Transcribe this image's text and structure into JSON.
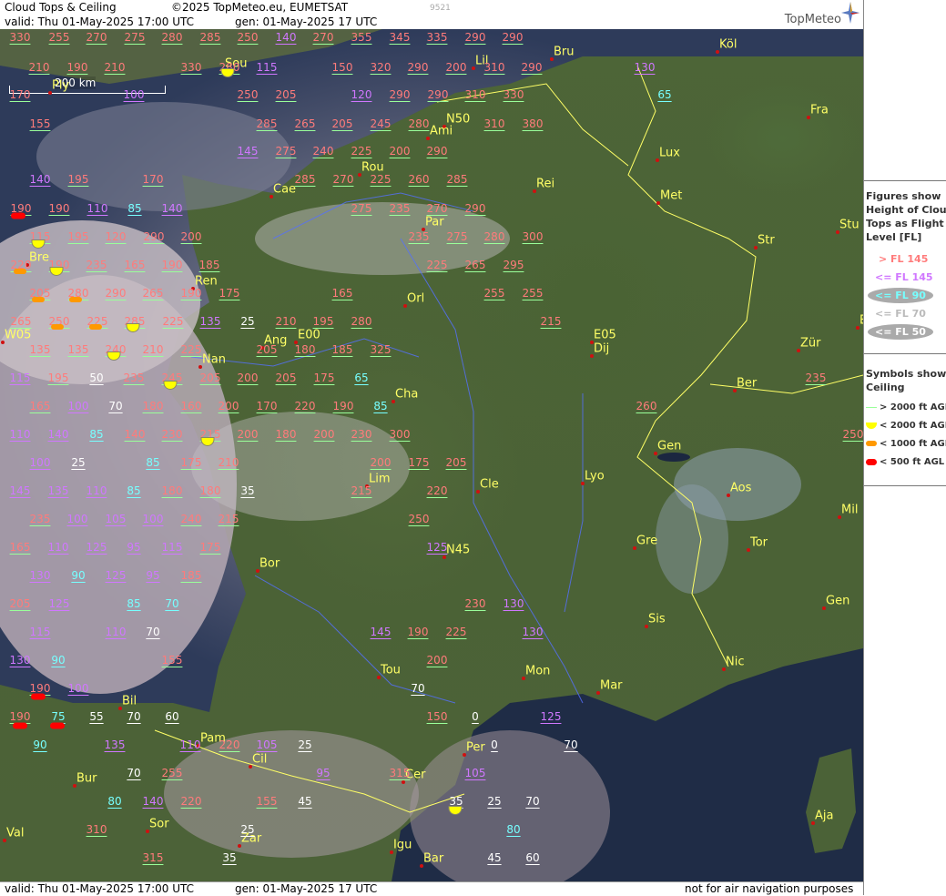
{
  "header": {
    "title": "Cloud Tops & Ceiling",
    "copyright": "©2025 TopMeteo.eu, EUMETSAT",
    "image_id": "9521",
    "valid": "valid:  Thu  01-May-2025  17:00 UTC",
    "gen": "gen: 01-May-2025 17 UTC",
    "logo": "TopMeteo"
  },
  "footer": {
    "valid": "valid:  Thu  01-May-2025  17:00 UTC",
    "gen": "gen: 01-May-2025 17 UTC",
    "note": "not for air navigation purposes"
  },
  "scale": {
    "label": "200 km"
  },
  "legend": {
    "title": [
      "Figures show",
      "Height of Cloud",
      "Tops as Flight",
      "Level  [FL]"
    ],
    "items": [
      {
        "text": "> FL 145",
        "color": "#ff7b7b"
      },
      {
        "text": "<= FL 145",
        "color": "#d077ff"
      },
      {
        "text": "<= FL 90",
        "color": "#77ffff"
      },
      {
        "text": "<= FL 70",
        "color": "#bbbbbb"
      },
      {
        "text": "<= FL 50",
        "color": "#ffffff"
      }
    ],
    "symbols_title": [
      "Symbols show",
      "Ceiling"
    ],
    "symbols": [
      {
        "text": "> 2000 ft AGL",
        "color": "#9aff9a"
      },
      {
        "text": "< 2000 ft AGL",
        "color": "#ffff00"
      },
      {
        "text": "< 1000 ft AGL",
        "color": "#ff9900"
      },
      {
        "text": "< 500 ft AGL",
        "color": "#ff0000"
      }
    ]
  },
  "cities": [
    {
      "name": "Sou"
    },
    {
      "name": "Bru"
    },
    {
      "name": "Köl"
    },
    {
      "name": "Lil"
    },
    {
      "name": "Ply"
    },
    {
      "name": "Fra"
    },
    {
      "name": "N50"
    },
    {
      "name": "Ami"
    },
    {
      "name": "Lux"
    },
    {
      "name": "Rou"
    },
    {
      "name": "Cae"
    },
    {
      "name": "Rei"
    },
    {
      "name": "Met"
    },
    {
      "name": "Par"
    },
    {
      "name": "Stu"
    },
    {
      "name": "Str"
    },
    {
      "name": "Bre"
    },
    {
      "name": "Ren"
    },
    {
      "name": "Orl"
    },
    {
      "name": "W05"
    },
    {
      "name": "Ang"
    },
    {
      "name": "E00"
    },
    {
      "name": "E05"
    },
    {
      "name": "Dij"
    },
    {
      "name": "Zür"
    },
    {
      "name": "Nan"
    },
    {
      "name": "Cha"
    },
    {
      "name": "Ber"
    },
    {
      "name": "Gen"
    },
    {
      "name": "Lim"
    },
    {
      "name": "Cle"
    },
    {
      "name": "Lyo"
    },
    {
      "name": "Aos"
    },
    {
      "name": "Mil"
    },
    {
      "name": "Gre"
    },
    {
      "name": "Tor"
    },
    {
      "name": "N45"
    },
    {
      "name": "Bor"
    },
    {
      "name": "Gen"
    },
    {
      "name": "Sis"
    },
    {
      "name": "Nic"
    },
    {
      "name": "Tou"
    },
    {
      "name": "Mon"
    },
    {
      "name": "Mar"
    },
    {
      "name": "Bil"
    },
    {
      "name": "Pam"
    },
    {
      "name": "Per"
    },
    {
      "name": "Cil"
    },
    {
      "name": "Cer"
    },
    {
      "name": "Bur"
    },
    {
      "name": "Sor"
    },
    {
      "name": "Val"
    },
    {
      "name": "Zar"
    },
    {
      "name": "Igu"
    },
    {
      "name": "Bar"
    },
    {
      "name": "Aja"
    },
    {
      "name": "E"
    }
  ],
  "cloud_tops": [
    {
      "v": "330",
      "c": "pink"
    },
    {
      "v": "255",
      "c": "pink"
    },
    {
      "v": "270",
      "c": "pink"
    },
    {
      "v": "275",
      "c": "pink"
    },
    {
      "v": "280",
      "c": "pink"
    },
    {
      "v": "285",
      "c": "pink"
    },
    {
      "v": "250",
      "c": "pink"
    },
    {
      "v": "140",
      "c": "purple"
    },
    {
      "v": "270",
      "c": "pink"
    },
    {
      "v": "355",
      "c": "pink"
    },
    {
      "v": "345",
      "c": "pink"
    },
    {
      "v": "335",
      "c": "pink"
    },
    {
      "v": "290",
      "c": "pink"
    },
    {
      "v": "290",
      "c": "pink"
    },
    {
      "v": "210",
      "c": "pink"
    },
    {
      "v": "190",
      "c": "pink"
    },
    {
      "v": "210",
      "c": "pink"
    },
    {
      "v": "330",
      "c": "pink"
    },
    {
      "v": "280",
      "c": "pink"
    },
    {
      "v": "115",
      "c": "purple"
    },
    {
      "v": "150",
      "c": "pink"
    },
    {
      "v": "320",
      "c": "pink"
    },
    {
      "v": "290",
      "c": "pink"
    },
    {
      "v": "200",
      "c": "pink"
    },
    {
      "v": "310",
      "c": "pink"
    },
    {
      "v": "290",
      "c": "pink"
    },
    {
      "v": "130",
      "c": "purple"
    },
    {
      "v": "170",
      "c": "pink"
    },
    {
      "v": "100",
      "c": "purple"
    },
    {
      "v": "250",
      "c": "pink"
    },
    {
      "v": "205",
      "c": "pink"
    },
    {
      "v": "120",
      "c": "purple"
    },
    {
      "v": "290",
      "c": "pink"
    },
    {
      "v": "290",
      "c": "pink"
    },
    {
      "v": "310",
      "c": "pink"
    },
    {
      "v": "330",
      "c": "pink"
    },
    {
      "v": "65",
      "c": "cyan"
    },
    {
      "v": "155",
      "c": "pink"
    },
    {
      "v": "285",
      "c": "pink"
    },
    {
      "v": "265",
      "c": "pink"
    },
    {
      "v": "205",
      "c": "pink"
    },
    {
      "v": "245",
      "c": "pink"
    },
    {
      "v": "280",
      "c": "pink"
    },
    {
      "v": "310",
      "c": "pink"
    },
    {
      "v": "380",
      "c": "pink"
    },
    {
      "v": "145",
      "c": "purple"
    },
    {
      "v": "275",
      "c": "pink"
    },
    {
      "v": "240",
      "c": "pink"
    },
    {
      "v": "225",
      "c": "pink"
    },
    {
      "v": "200",
      "c": "pink"
    },
    {
      "v": "290",
      "c": "pink"
    },
    {
      "v": "140",
      "c": "purple"
    },
    {
      "v": "195",
      "c": "pink"
    },
    {
      "v": "170",
      "c": "pink"
    },
    {
      "v": "285",
      "c": "pink"
    },
    {
      "v": "270",
      "c": "pink"
    },
    {
      "v": "225",
      "c": "pink"
    },
    {
      "v": "260",
      "c": "pink"
    },
    {
      "v": "285",
      "c": "pink"
    },
    {
      "v": "190",
      "c": "pink"
    },
    {
      "v": "190",
      "c": "pink"
    },
    {
      "v": "110",
      "c": "purple"
    },
    {
      "v": "85",
      "c": "cyan"
    },
    {
      "v": "140",
      "c": "purple"
    },
    {
      "v": "275",
      "c": "pink"
    },
    {
      "v": "235",
      "c": "pink"
    },
    {
      "v": "270",
      "c": "pink"
    },
    {
      "v": "290",
      "c": "pink"
    },
    {
      "v": "115",
      "c": "pink"
    },
    {
      "v": "195",
      "c": "pink"
    },
    {
      "v": "120",
      "c": "pink"
    },
    {
      "v": "290",
      "c": "pink"
    },
    {
      "v": "200",
      "c": "pink"
    },
    {
      "v": "235",
      "c": "pink"
    },
    {
      "v": "275",
      "c": "pink"
    },
    {
      "v": "280",
      "c": "pink"
    },
    {
      "v": "300",
      "c": "pink"
    },
    {
      "v": "220",
      "c": "pink"
    },
    {
      "v": "190",
      "c": "pink"
    },
    {
      "v": "235",
      "c": "pink"
    },
    {
      "v": "165",
      "c": "pink"
    },
    {
      "v": "190",
      "c": "pink"
    },
    {
      "v": "185",
      "c": "pink"
    },
    {
      "v": "225",
      "c": "pink"
    },
    {
      "v": "265",
      "c": "pink"
    },
    {
      "v": "295",
      "c": "pink"
    },
    {
      "v": "205",
      "c": "pink"
    },
    {
      "v": "280",
      "c": "pink"
    },
    {
      "v": "290",
      "c": "pink"
    },
    {
      "v": "265",
      "c": "pink"
    },
    {
      "v": "190",
      "c": "pink"
    },
    {
      "v": "175",
      "c": "pink"
    },
    {
      "v": "165",
      "c": "pink"
    },
    {
      "v": "255",
      "c": "pink"
    },
    {
      "v": "255",
      "c": "pink"
    },
    {
      "v": "265",
      "c": "pink"
    },
    {
      "v": "250",
      "c": "pink"
    },
    {
      "v": "225",
      "c": "pink"
    },
    {
      "v": "285",
      "c": "pink"
    },
    {
      "v": "225",
      "c": "pink"
    },
    {
      "v": "135",
      "c": "purple"
    },
    {
      "v": "25",
      "c": "gray"
    },
    {
      "v": "210",
      "c": "pink"
    },
    {
      "v": "195",
      "c": "pink"
    },
    {
      "v": "280",
      "c": "pink"
    },
    {
      "v": "215",
      "c": "pink"
    },
    {
      "v": "135",
      "c": "pink"
    },
    {
      "v": "135",
      "c": "pink"
    },
    {
      "v": "240",
      "c": "pink"
    },
    {
      "v": "210",
      "c": "pink"
    },
    {
      "v": "225",
      "c": "pink"
    },
    {
      "v": "205",
      "c": "pink"
    },
    {
      "v": "180",
      "c": "pink"
    },
    {
      "v": "185",
      "c": "pink"
    },
    {
      "v": "325",
      "c": "pink"
    },
    {
      "v": "115",
      "c": "purple"
    },
    {
      "v": "195",
      "c": "pink"
    },
    {
      "v": "50",
      "c": "gray"
    },
    {
      "v": "235",
      "c": "pink"
    },
    {
      "v": "245",
      "c": "pink"
    },
    {
      "v": "205",
      "c": "pink"
    },
    {
      "v": "200",
      "c": "pink"
    },
    {
      "v": "205",
      "c": "pink"
    },
    {
      "v": "175",
      "c": "pink"
    },
    {
      "v": "65",
      "c": "cyan"
    },
    {
      "v": "235",
      "c": "pink"
    },
    {
      "v": "165",
      "c": "pink"
    },
    {
      "v": "100",
      "c": "purple"
    },
    {
      "v": "70",
      "c": "gray"
    },
    {
      "v": "180",
      "c": "pink"
    },
    {
      "v": "160",
      "c": "pink"
    },
    {
      "v": "200",
      "c": "pink"
    },
    {
      "v": "170",
      "c": "pink"
    },
    {
      "v": "220",
      "c": "pink"
    },
    {
      "v": "190",
      "c": "pink"
    },
    {
      "v": "85",
      "c": "cyan"
    },
    {
      "v": "260",
      "c": "pink"
    },
    {
      "v": "110",
      "c": "purple"
    },
    {
      "v": "140",
      "c": "purple"
    },
    {
      "v": "85",
      "c": "cyan"
    },
    {
      "v": "140",
      "c": "pink"
    },
    {
      "v": "230",
      "c": "pink"
    },
    {
      "v": "215",
      "c": "pink"
    },
    {
      "v": "200",
      "c": "pink"
    },
    {
      "v": "180",
      "c": "pink"
    },
    {
      "v": "200",
      "c": "pink"
    },
    {
      "v": "230",
      "c": "pink"
    },
    {
      "v": "300",
      "c": "pink"
    },
    {
      "v": "250",
      "c": "pink"
    },
    {
      "v": "100",
      "c": "purple"
    },
    {
      "v": "25",
      "c": "gray"
    },
    {
      "v": "85",
      "c": "cyan"
    },
    {
      "v": "175",
      "c": "pink"
    },
    {
      "v": "210",
      "c": "pink"
    },
    {
      "v": "200",
      "c": "pink"
    },
    {
      "v": "175",
      "c": "pink"
    },
    {
      "v": "205",
      "c": "pink"
    },
    {
      "v": "145",
      "c": "purple"
    },
    {
      "v": "135",
      "c": "purple"
    },
    {
      "v": "110",
      "c": "purple"
    },
    {
      "v": "85",
      "c": "cyan"
    },
    {
      "v": "180",
      "c": "pink"
    },
    {
      "v": "180",
      "c": "pink"
    },
    {
      "v": "35",
      "c": "gray"
    },
    {
      "v": "215",
      "c": "pink"
    },
    {
      "v": "220",
      "c": "pink"
    },
    {
      "v": "235",
      "c": "pink"
    },
    {
      "v": "100",
      "c": "purple"
    },
    {
      "v": "105",
      "c": "purple"
    },
    {
      "v": "100",
      "c": "purple"
    },
    {
      "v": "240",
      "c": "pink"
    },
    {
      "v": "215",
      "c": "pink"
    },
    {
      "v": "250",
      "c": "pink"
    },
    {
      "v": "165",
      "c": "pink"
    },
    {
      "v": "110",
      "c": "purple"
    },
    {
      "v": "125",
      "c": "purple"
    },
    {
      "v": "95",
      "c": "purple"
    },
    {
      "v": "115",
      "c": "purple"
    },
    {
      "v": "175",
      "c": "pink"
    },
    {
      "v": "125",
      "c": "purple"
    },
    {
      "v": "130",
      "c": "purple"
    },
    {
      "v": "90",
      "c": "cyan"
    },
    {
      "v": "125",
      "c": "purple"
    },
    {
      "v": "95",
      "c": "purple"
    },
    {
      "v": "185",
      "c": "pink"
    },
    {
      "v": "205",
      "c": "pink"
    },
    {
      "v": "125",
      "c": "purple"
    },
    {
      "v": "85",
      "c": "cyan"
    },
    {
      "v": "70",
      "c": "cyan"
    },
    {
      "v": "230",
      "c": "pink"
    },
    {
      "v": "130",
      "c": "purple"
    },
    {
      "v": "115",
      "c": "purple"
    },
    {
      "v": "110",
      "c": "purple"
    },
    {
      "v": "70",
      "c": "gray"
    },
    {
      "v": "145",
      "c": "purple"
    },
    {
      "v": "190",
      "c": "pink"
    },
    {
      "v": "225",
      "c": "pink"
    },
    {
      "v": "130",
      "c": "purple"
    },
    {
      "v": "130",
      "c": "purple"
    },
    {
      "v": "90",
      "c": "cyan"
    },
    {
      "v": "155",
      "c": "pink"
    },
    {
      "v": "200",
      "c": "pink"
    },
    {
      "v": "190",
      "c": "pink"
    },
    {
      "v": "100",
      "c": "purple"
    },
    {
      "v": "70",
      "c": "gray"
    },
    {
      "v": "190",
      "c": "pink"
    },
    {
      "v": "75",
      "c": "cyan"
    },
    {
      "v": "55",
      "c": "gray"
    },
    {
      "v": "70",
      "c": "gray"
    },
    {
      "v": "60",
      "c": "gray"
    },
    {
      "v": "150",
      "c": "pink"
    },
    {
      "v": "0",
      "c": "gray"
    },
    {
      "v": "125",
      "c": "purple"
    },
    {
      "v": "90",
      "c": "cyan"
    },
    {
      "v": "135",
      "c": "purple"
    },
    {
      "v": "110",
      "c": "purple"
    },
    {
      "v": "220",
      "c": "pink"
    },
    {
      "v": "105",
      "c": "purple"
    },
    {
      "v": "25",
      "c": "gray"
    },
    {
      "v": "0",
      "c": "gray"
    },
    {
      "v": "70",
      "c": "gray"
    },
    {
      "v": "70",
      "c": "gray"
    },
    {
      "v": "255",
      "c": "pink"
    },
    {
      "v": "95",
      "c": "purple"
    },
    {
      "v": "315",
      "c": "pink"
    },
    {
      "v": "105",
      "c": "purple"
    },
    {
      "v": "80",
      "c": "cyan"
    },
    {
      "v": "140",
      "c": "purple"
    },
    {
      "v": "220",
      "c": "pink"
    },
    {
      "v": "155",
      "c": "pink"
    },
    {
      "v": "45",
      "c": "gray"
    },
    {
      "v": "35",
      "c": "gray"
    },
    {
      "v": "25",
      "c": "gray"
    },
    {
      "v": "70",
      "c": "gray"
    },
    {
      "v": "310",
      "c": "pink"
    },
    {
      "v": "25",
      "c": "gray"
    },
    {
      "v": "80",
      "c": "cyan"
    },
    {
      "v": "315",
      "c": "pink"
    },
    {
      "v": "35",
      "c": "gray"
    },
    {
      "v": "45",
      "c": "gray"
    },
    {
      "v": "60",
      "c": "gray"
    }
  ],
  "ceiling_symbols": [
    {
      "level": "yellow"
    },
    {
      "level": "red"
    },
    {
      "level": "yellow"
    },
    {
      "level": "yellow"
    },
    {
      "level": "orange"
    },
    {
      "level": "orange"
    },
    {
      "level": "orange"
    },
    {
      "level": "orange"
    },
    {
      "level": "orange"
    },
    {
      "level": "yellow"
    },
    {
      "level": "yellow"
    },
    {
      "level": "yellow"
    },
    {
      "level": "yellow"
    },
    {
      "level": "red"
    },
    {
      "level": "red"
    },
    {
      "level": "red"
    },
    {
      "level": "yellow"
    }
  ]
}
